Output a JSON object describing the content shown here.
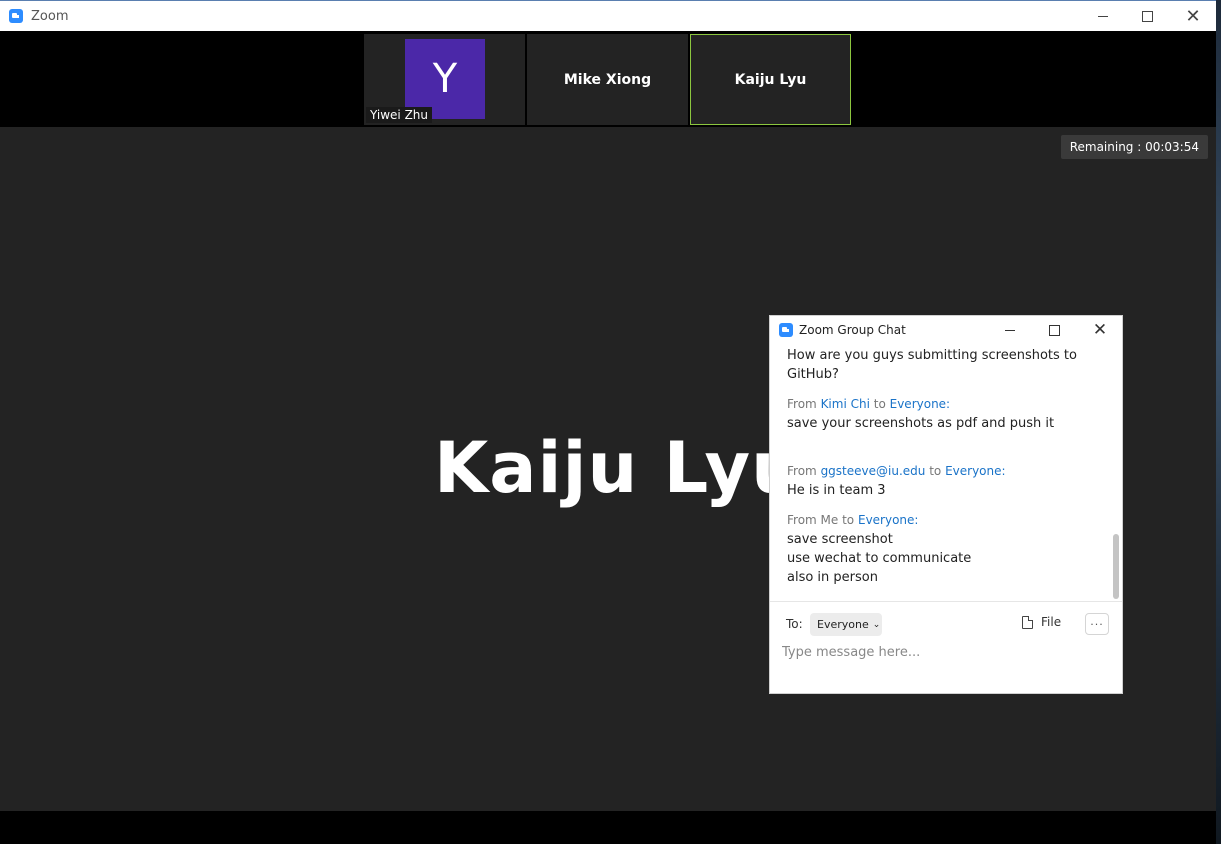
{
  "window": {
    "app_title": "Zoom"
  },
  "thumbnails": [
    {
      "name": "Yiwei Zhu",
      "avatar_letter": "Y",
      "avatar_color": "#4b28a8"
    },
    {
      "name": "Mike Xiong"
    },
    {
      "name": "Kaiju Lyu",
      "active": true
    }
  ],
  "stage": {
    "speaker_name": "Kaiju Lyu",
    "remaining": "Remaining : 00:03:54"
  },
  "chat": {
    "title": "Zoom Group Chat",
    "messages": [
      {
        "lines": [
          "How are you guys submitting screenshots to",
          "GitHub?"
        ]
      },
      {
        "from_prefix": "From",
        "from": "Kimi Chi",
        "to_word": "to",
        "to": "Everyone:",
        "lines": [
          "save your screenshots as pdf and push it"
        ]
      },
      {
        "from_prefix": "From",
        "from": "ggsteeve@iu.edu",
        "to_word": "to",
        "to": "Everyone:",
        "lines": [
          "He is in team 3"
        ]
      },
      {
        "from_prefix": "From Me to",
        "to": "Everyone:",
        "lines": [
          "save screenshot",
          "use wechat to communicate",
          "also in person"
        ]
      }
    ],
    "composer": {
      "to_label": "To:",
      "to_value": "Everyone",
      "file_label": "File",
      "more_label": "···",
      "placeholder": "Type message here..."
    }
  },
  "colors": {
    "accent": "#2d8cff",
    "active_border": "#8cc63f",
    "link": "#1a73c8"
  }
}
